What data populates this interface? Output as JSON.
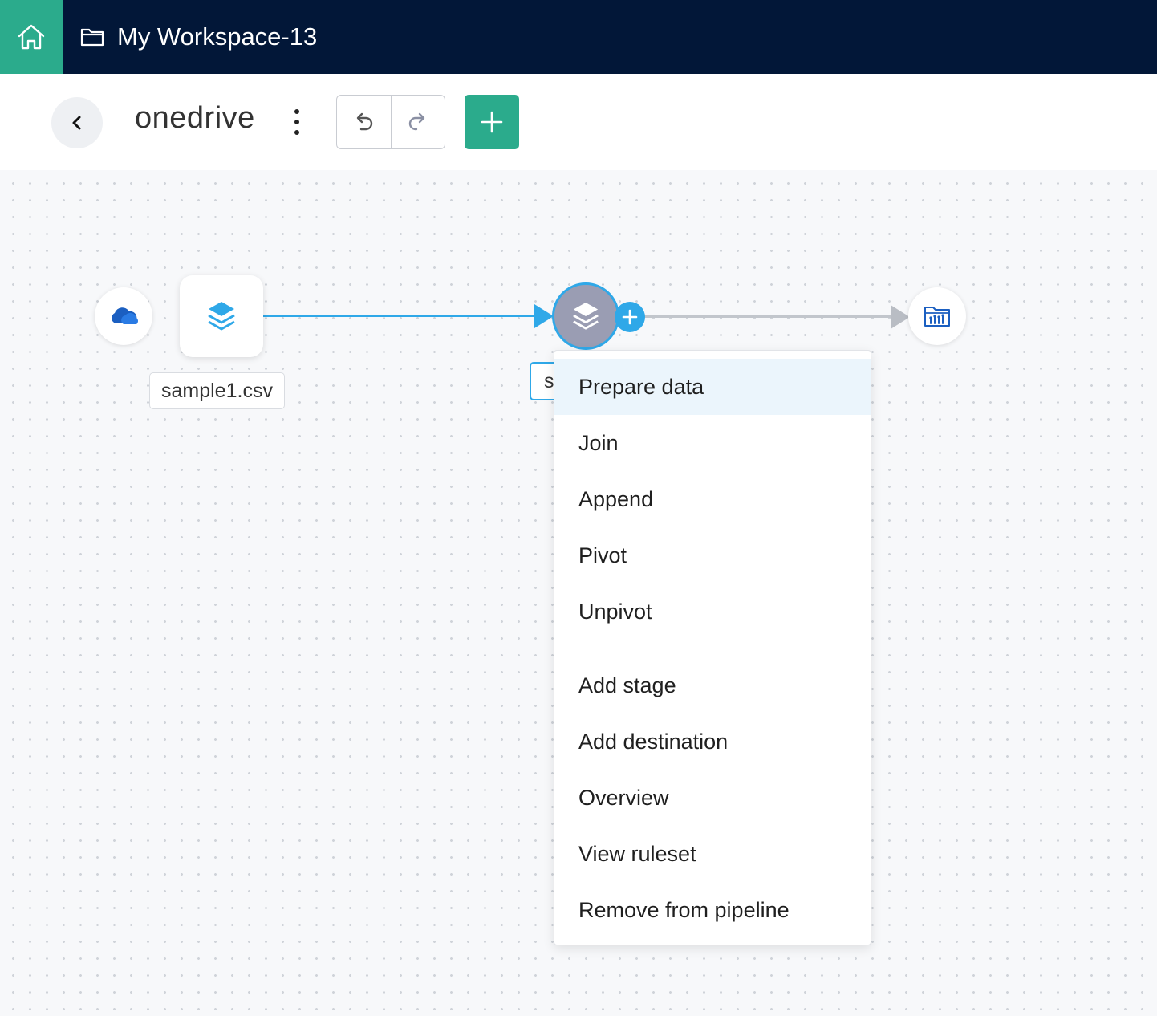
{
  "header": {
    "workspace_title": "My Workspace-13",
    "home_icon": "home-icon",
    "folder_icon": "folder-icon"
  },
  "toolbar": {
    "pipeline_name": "onedrive"
  },
  "canvas": {
    "source_icon": "onedrive-cloud-icon",
    "dataset_label": "sample1.csv",
    "stage_label_partial": "s",
    "destination_icon": "folder-chart-icon"
  },
  "context_menu": {
    "group1": [
      "Prepare data",
      "Join",
      "Append",
      "Pivot",
      "Unpivot"
    ],
    "group2": [
      "Add stage",
      "Add destination",
      "Overview",
      "View ruleset",
      "Remove from pipeline"
    ],
    "active_item": "Prepare data"
  },
  "colors": {
    "topbar": "#021738",
    "accent_green": "#2bab8c",
    "accent_blue": "#2fa8e8",
    "stage_node": "#9a9db3",
    "menu_highlight": "#ebf5fc"
  }
}
